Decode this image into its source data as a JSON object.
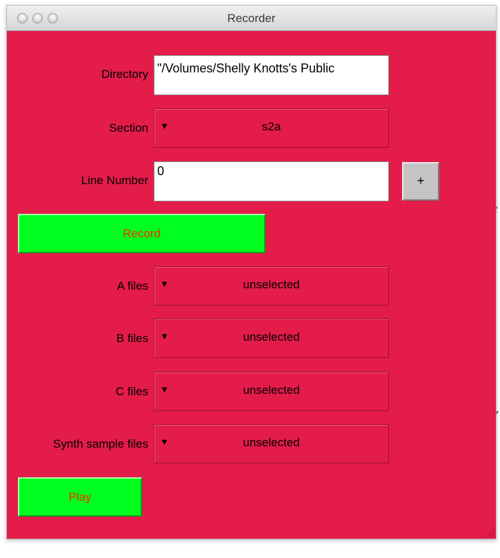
{
  "window": {
    "title": "Recorder"
  },
  "edge_text": {
    "top": "e",
    "bottom": "y"
  },
  "form": {
    "directory": {
      "label": "Directory",
      "value": "\"/Volumes/Shelly Knotts's Public"
    },
    "section": {
      "label": "Section",
      "value": "s2a"
    },
    "line_number": {
      "label": "Line Number",
      "value": "0",
      "increment_label": "+"
    },
    "record_label": "Record",
    "a_files": {
      "label": "A files",
      "value": "unselected"
    },
    "b_files": {
      "label": "B files",
      "value": "unselected"
    },
    "c_files": {
      "label": "C files",
      "value": "unselected"
    },
    "synth_files": {
      "label": "Synth sample files",
      "value": "unselected"
    },
    "play_label": "Play",
    "popup_arrow": "▼"
  },
  "colors": {
    "background": "#e31c4a",
    "button_green": "#00ff1f",
    "button_text": "#ff2a00"
  }
}
